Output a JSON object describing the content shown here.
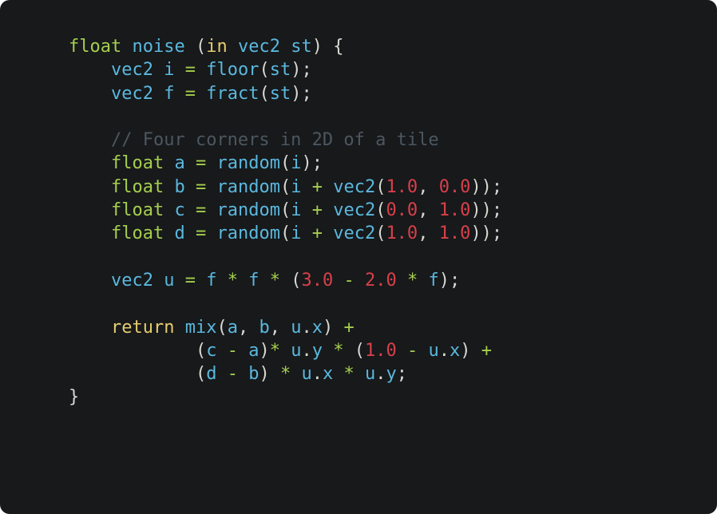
{
  "editor": {
    "theme_colors": {
      "background": "#17191b",
      "type": "#a6ce4e",
      "function": "#5bb8de",
      "keyword": "#e6cc6e",
      "number": "#d8404a",
      "comment": "#4c5760",
      "operator": "#a6ce4e",
      "punctuation": "#d8d8d2"
    },
    "lines": [
      [
        [
          "type",
          "float"
        ],
        [
          "plain",
          " "
        ],
        [
          "fn",
          "noise"
        ],
        [
          "plain",
          " "
        ],
        [
          "punc",
          "("
        ],
        [
          "kw",
          "in"
        ],
        [
          "plain",
          " "
        ],
        [
          "type2",
          "vec2"
        ],
        [
          "plain",
          " "
        ],
        [
          "var",
          "st"
        ],
        [
          "punc",
          ")"
        ],
        [
          "plain",
          " "
        ],
        [
          "punc",
          "{"
        ]
      ],
      [
        [
          "plain",
          "    "
        ],
        [
          "fn",
          "vec2"
        ],
        [
          "plain",
          " "
        ],
        [
          "var",
          "i"
        ],
        [
          "plain",
          " "
        ],
        [
          "op",
          "="
        ],
        [
          "plain",
          " "
        ],
        [
          "fn",
          "floor"
        ],
        [
          "punc",
          "("
        ],
        [
          "var",
          "st"
        ],
        [
          "punc",
          ");"
        ]
      ],
      [
        [
          "plain",
          "    "
        ],
        [
          "fn",
          "vec2"
        ],
        [
          "plain",
          " "
        ],
        [
          "var",
          "f"
        ],
        [
          "plain",
          " "
        ],
        [
          "op",
          "="
        ],
        [
          "plain",
          " "
        ],
        [
          "fn",
          "fract"
        ],
        [
          "punc",
          "("
        ],
        [
          "var",
          "st"
        ],
        [
          "punc",
          ");"
        ]
      ],
      [],
      [
        [
          "plain",
          "    "
        ],
        [
          "com",
          "// Four corners in 2D of a tile"
        ]
      ],
      [
        [
          "plain",
          "    "
        ],
        [
          "type",
          "float"
        ],
        [
          "plain",
          " "
        ],
        [
          "var",
          "a"
        ],
        [
          "plain",
          " "
        ],
        [
          "op",
          "="
        ],
        [
          "plain",
          " "
        ],
        [
          "fn",
          "random"
        ],
        [
          "punc",
          "("
        ],
        [
          "var",
          "i"
        ],
        [
          "punc",
          ");"
        ]
      ],
      [
        [
          "plain",
          "    "
        ],
        [
          "type",
          "float"
        ],
        [
          "plain",
          " "
        ],
        [
          "var",
          "b"
        ],
        [
          "plain",
          " "
        ],
        [
          "op",
          "="
        ],
        [
          "plain",
          " "
        ],
        [
          "fn",
          "random"
        ],
        [
          "punc",
          "("
        ],
        [
          "var",
          "i"
        ],
        [
          "plain",
          " "
        ],
        [
          "op",
          "+"
        ],
        [
          "plain",
          " "
        ],
        [
          "fn",
          "vec2"
        ],
        [
          "punc",
          "("
        ],
        [
          "num",
          "1.0"
        ],
        [
          "punc",
          ", "
        ],
        [
          "num",
          "0.0"
        ],
        [
          "punc",
          "));"
        ]
      ],
      [
        [
          "plain",
          "    "
        ],
        [
          "type",
          "float"
        ],
        [
          "plain",
          " "
        ],
        [
          "var",
          "c"
        ],
        [
          "plain",
          " "
        ],
        [
          "op",
          "="
        ],
        [
          "plain",
          " "
        ],
        [
          "fn",
          "random"
        ],
        [
          "punc",
          "("
        ],
        [
          "var",
          "i"
        ],
        [
          "plain",
          " "
        ],
        [
          "op",
          "+"
        ],
        [
          "plain",
          " "
        ],
        [
          "fn",
          "vec2"
        ],
        [
          "punc",
          "("
        ],
        [
          "num",
          "0.0"
        ],
        [
          "punc",
          ", "
        ],
        [
          "num",
          "1.0"
        ],
        [
          "punc",
          "));"
        ]
      ],
      [
        [
          "plain",
          "    "
        ],
        [
          "type",
          "float"
        ],
        [
          "plain",
          " "
        ],
        [
          "var",
          "d"
        ],
        [
          "plain",
          " "
        ],
        [
          "op",
          "="
        ],
        [
          "plain",
          " "
        ],
        [
          "fn",
          "random"
        ],
        [
          "punc",
          "("
        ],
        [
          "var",
          "i"
        ],
        [
          "plain",
          " "
        ],
        [
          "op",
          "+"
        ],
        [
          "plain",
          " "
        ],
        [
          "fn",
          "vec2"
        ],
        [
          "punc",
          "("
        ],
        [
          "num",
          "1.0"
        ],
        [
          "punc",
          ", "
        ],
        [
          "num",
          "1.0"
        ],
        [
          "punc",
          "));"
        ]
      ],
      [],
      [
        [
          "plain",
          "    "
        ],
        [
          "fn",
          "vec2"
        ],
        [
          "plain",
          " "
        ],
        [
          "var",
          "u"
        ],
        [
          "plain",
          " "
        ],
        [
          "op",
          "="
        ],
        [
          "plain",
          " "
        ],
        [
          "var",
          "f"
        ],
        [
          "plain",
          " "
        ],
        [
          "op",
          "*"
        ],
        [
          "plain",
          " "
        ],
        [
          "var",
          "f"
        ],
        [
          "plain",
          " "
        ],
        [
          "op",
          "*"
        ],
        [
          "plain",
          " "
        ],
        [
          "punc",
          "("
        ],
        [
          "num",
          "3.0"
        ],
        [
          "plain",
          " "
        ],
        [
          "op",
          "-"
        ],
        [
          "plain",
          " "
        ],
        [
          "num",
          "2.0"
        ],
        [
          "plain",
          " "
        ],
        [
          "op",
          "*"
        ],
        [
          "plain",
          " "
        ],
        [
          "var",
          "f"
        ],
        [
          "punc",
          ");"
        ]
      ],
      [],
      [
        [
          "plain",
          "    "
        ],
        [
          "kw",
          "return"
        ],
        [
          "plain",
          " "
        ],
        [
          "fn",
          "mix"
        ],
        [
          "punc",
          "("
        ],
        [
          "var",
          "a"
        ],
        [
          "punc",
          ", "
        ],
        [
          "var",
          "b"
        ],
        [
          "punc",
          ", "
        ],
        [
          "var",
          "u"
        ],
        [
          "punc",
          "."
        ],
        [
          "var",
          "x"
        ],
        [
          "punc",
          ")"
        ],
        [
          "plain",
          " "
        ],
        [
          "op",
          "+"
        ]
      ],
      [
        [
          "plain",
          "            "
        ],
        [
          "punc",
          "("
        ],
        [
          "var",
          "c"
        ],
        [
          "plain",
          " "
        ],
        [
          "op",
          "-"
        ],
        [
          "plain",
          " "
        ],
        [
          "var",
          "a"
        ],
        [
          "punc",
          ")"
        ],
        [
          "op",
          "*"
        ],
        [
          "plain",
          " "
        ],
        [
          "var",
          "u"
        ],
        [
          "punc",
          "."
        ],
        [
          "var",
          "y"
        ],
        [
          "plain",
          " "
        ],
        [
          "op",
          "*"
        ],
        [
          "plain",
          " "
        ],
        [
          "punc",
          "("
        ],
        [
          "num",
          "1.0"
        ],
        [
          "plain",
          " "
        ],
        [
          "op",
          "-"
        ],
        [
          "plain",
          " "
        ],
        [
          "var",
          "u"
        ],
        [
          "punc",
          "."
        ],
        [
          "var",
          "x"
        ],
        [
          "punc",
          ")"
        ],
        [
          "plain",
          " "
        ],
        [
          "op",
          "+"
        ]
      ],
      [
        [
          "plain",
          "            "
        ],
        [
          "punc",
          "("
        ],
        [
          "var",
          "d"
        ],
        [
          "plain",
          " "
        ],
        [
          "op",
          "-"
        ],
        [
          "plain",
          " "
        ],
        [
          "var",
          "b"
        ],
        [
          "punc",
          ")"
        ],
        [
          "plain",
          " "
        ],
        [
          "op",
          "*"
        ],
        [
          "plain",
          " "
        ],
        [
          "var",
          "u"
        ],
        [
          "punc",
          "."
        ],
        [
          "var",
          "x"
        ],
        [
          "plain",
          " "
        ],
        [
          "op",
          "*"
        ],
        [
          "plain",
          " "
        ],
        [
          "var",
          "u"
        ],
        [
          "punc",
          "."
        ],
        [
          "var",
          "y"
        ],
        [
          "punc",
          ";"
        ]
      ],
      [
        [
          "punc",
          "}"
        ]
      ]
    ]
  }
}
